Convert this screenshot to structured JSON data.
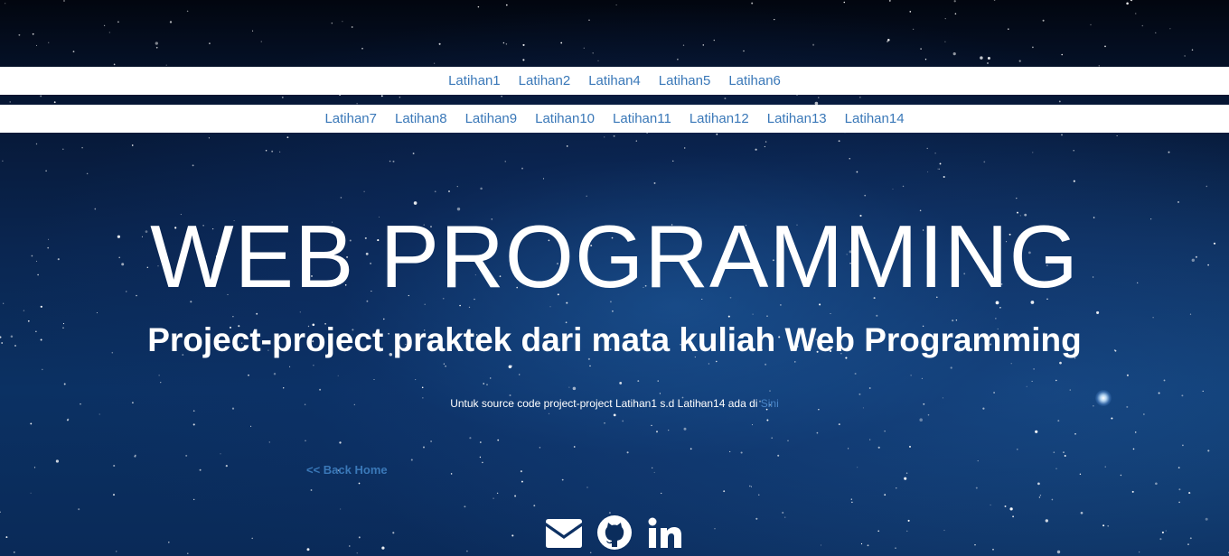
{
  "nav": {
    "row1": [
      "Latihan1",
      "Latihan2",
      "Latihan4",
      "Latihan5",
      "Latihan6"
    ],
    "row2": [
      "Latihan7",
      "Latihan8",
      "Latihan9",
      "Latihan10",
      "Latihan11",
      "Latihan12",
      "Latihan13",
      "Latihan14"
    ]
  },
  "hero": {
    "title": "WEB PROGRAMMING",
    "subtitle": "Project-project praktek dari mata kuliah Web Programming"
  },
  "source_note": {
    "text": "Untuk source code project-project Latihan1 s.d Latihan14 ada di ",
    "link_label": "Sini"
  },
  "back_home": {
    "label": "<< Back Home"
  },
  "social": {
    "icons": [
      "envelope-icon",
      "github-icon",
      "linkedin-icon"
    ]
  },
  "colors": {
    "link": "#3a78b8",
    "background": "#0a2651",
    "navbar": "#ffffff"
  }
}
